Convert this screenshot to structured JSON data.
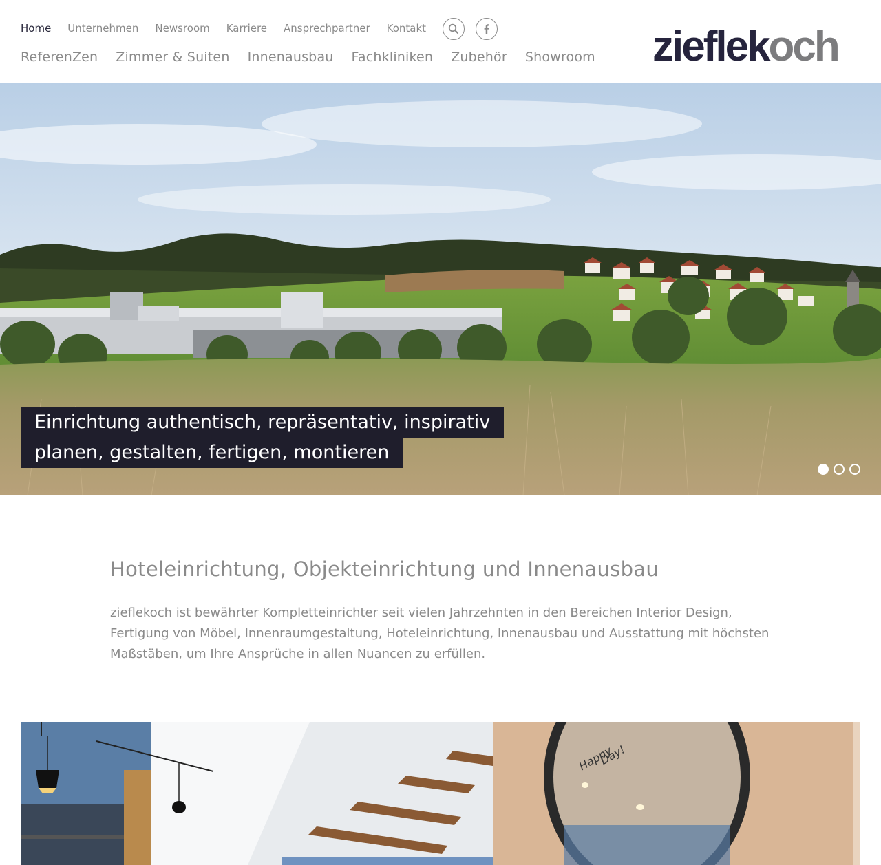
{
  "header": {
    "top_nav": [
      {
        "label": "Home",
        "active": true
      },
      {
        "label": "Unternehmen"
      },
      {
        "label": "Newsroom"
      },
      {
        "label": "Karriere"
      },
      {
        "label": "Ansprechpartner"
      },
      {
        "label": "Kontakt"
      }
    ],
    "icons": {
      "search": "search-icon",
      "facebook": "facebook-icon"
    },
    "main_nav": [
      {
        "label": "ReferenZen"
      },
      {
        "label": "Zimmer & Suiten"
      },
      {
        "label": "Innenausbau"
      },
      {
        "label": "Fachkliniken"
      },
      {
        "label": "Zubehör"
      },
      {
        "label": "Showroom"
      }
    ],
    "logo": {
      "part1": "ziefle",
      "part2": "k",
      "part3": "och",
      "dark_color": "#26243d",
      "grey_color": "#7c7c7e"
    }
  },
  "hero": {
    "caption_line1": "Einrichtung authentisch, repräsentativ, inspirativ",
    "caption_line2": "planen, gestalten, fertigen, montieren",
    "slides": 3,
    "active_slide": 1
  },
  "intro": {
    "title": "Hoteleinrichtung, Objekteinrichtung und Innenausbau",
    "body": "zieflekoch ist bewährter Kompletteinrichter seit vielen Jahrzehnten in den Bereichen Interior Design, Fertigung von Möbel, Innenraumgestaltung, Hoteleinrichtung, Innenausbau und Ausstattung mit höchsten Maßstäben, um Ihre Ansprüche in allen Nuancen zu erfüllen."
  },
  "gallery": {
    "mirror_text_1": "Happy",
    "mirror_text_2": "Day!"
  },
  "colors": {
    "accent_dark": "#1f1e2c",
    "text_grey": "#8a8a8a",
    "wall_blue": "#5a7ea6"
  }
}
